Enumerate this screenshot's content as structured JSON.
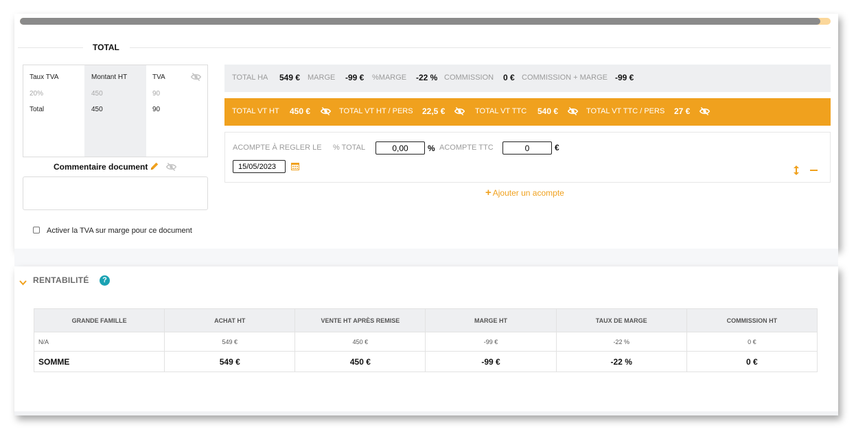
{
  "progress": {
    "fraction": 0.987,
    "fill_color": "#8a8a8a",
    "track_color": "#fbd79a"
  },
  "total_section": {
    "title": "TOTAL"
  },
  "tva_table": {
    "headers": [
      "Taux TVA",
      "Montant HT",
      "TVA"
    ],
    "rows": [
      {
        "taux": "20%",
        "montant": "450",
        "tva": "90"
      },
      {
        "taux": "Total",
        "montant": "450",
        "tva": "90"
      }
    ],
    "eye_icon": "eye-slash-icon"
  },
  "comment": {
    "label": "Commentaire document",
    "edit_icon": "pencil-icon",
    "visibility_icon": "eye-slash-icon",
    "value": ""
  },
  "tva_marge": {
    "label": "Activer la TVA sur marge pour ce document",
    "checked": false
  },
  "summary_bar": {
    "items": [
      {
        "label": "TOTAL HA",
        "value": "549 €"
      },
      {
        "label": "MARGE",
        "value": "-99 €"
      },
      {
        "label": "%MARGE",
        "value": "-22 %"
      },
      {
        "label": "COMMISSION",
        "value": "0 €"
      },
      {
        "label": "COMMISSION + MARGE",
        "value": "-99 €"
      }
    ]
  },
  "sales_bar": {
    "color": "#f0a11e",
    "items": [
      {
        "label": "TOTAL VT HT",
        "value": "450 €"
      },
      {
        "label": "TOTAL VT HT / PERS",
        "value": "22,5 €"
      },
      {
        "label": "TOTAL VT TTC",
        "value": "540 €"
      },
      {
        "label": "TOTAL VT TTC / PERS",
        "value": "27 €"
      }
    ]
  },
  "acompte": {
    "label": "ACOMPTE À REGLER LE",
    "pct_label": "% TOTAL",
    "pct_value": "0,00",
    "pct_unit": "%",
    "ttc_label": "ACOMPTE TTC",
    "ttc_value": "0",
    "ttc_unit": "€",
    "date": "15/05/2023",
    "add_label": "Ajouter un acompte"
  },
  "rentabilite": {
    "title": "RENTABILITÉ",
    "help": "?",
    "headers": [
      "GRANDE FAMILLE",
      "ACHAT HT",
      "VENTE HT APRÈS REMISE",
      "MARGE HT",
      "TAUX DE MARGE",
      "COMMISSION HT"
    ],
    "rows": [
      [
        "N/A",
        "549 €",
        "450 €",
        "-99 €",
        "-22 %",
        "0 €"
      ]
    ],
    "sum": [
      "SOMME",
      "549 €",
      "450 €",
      "-99 €",
      "-22 %",
      "0 €"
    ]
  }
}
